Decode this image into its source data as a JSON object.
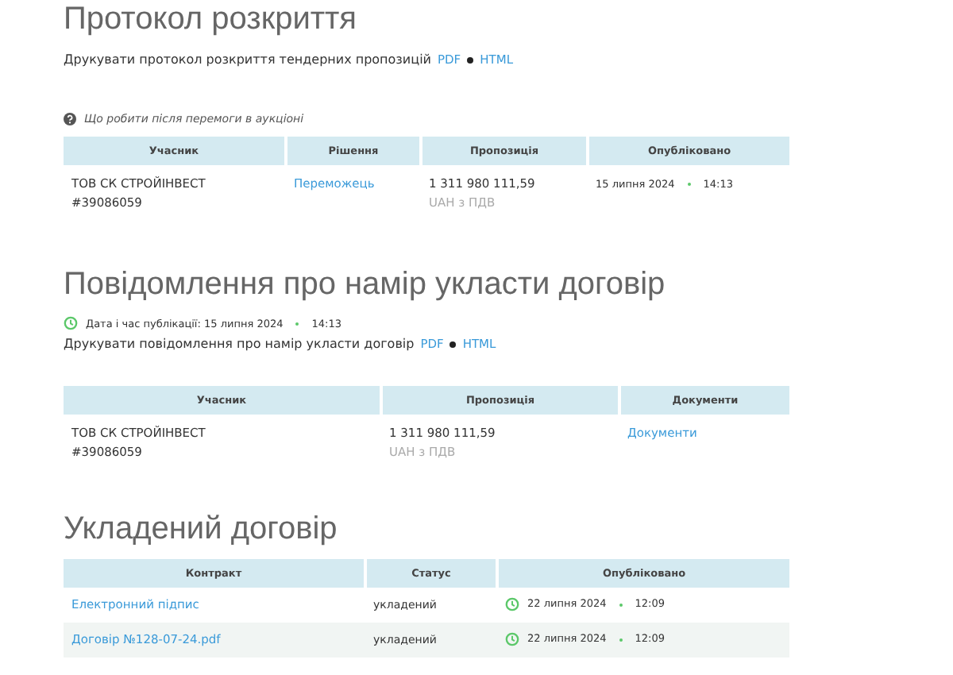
{
  "sections": [
    {
      "title": "Протокол розкриття",
      "print": {
        "text": "Друкувати протокол розкриття тендерних пропозицій",
        "links": [
          "PDF",
          "HTML"
        ]
      },
      "help": "Що робити після перемоги в аукціоні",
      "table": {
        "columns": [
          "Учасник",
          "Рішення",
          "Пропозиція",
          "Опубліковано"
        ],
        "rows": [
          [
            {
              "kind": "party",
              "name": "ТОВ СК СТРОЙІНВЕСТ",
              "code": "#39086059"
            },
            {
              "kind": "link",
              "text": "Переможець"
            },
            {
              "kind": "amount",
              "value": "1 311 980 111,59",
              "note": "UAH з ПДВ"
            },
            {
              "kind": "date",
              "date": "15 липня 2024",
              "time": "14:13"
            }
          ]
        ]
      }
    },
    {
      "title": "Повідомлення про намір укласти договір",
      "published": {
        "label": "Дата і час публікації: 15 липня 2024",
        "time": "14:13"
      },
      "print": {
        "text": "Друкувати повідомлення про намір укласти договір",
        "links": [
          "PDF",
          "HTML"
        ]
      },
      "table": {
        "columns": [
          "Учасник",
          "Пропозиція",
          "Документи"
        ],
        "rows": [
          [
            {
              "kind": "party",
              "name": "ТОВ СК СТРОЙІНВЕСТ",
              "code": "#39086059"
            },
            {
              "kind": "amount",
              "value": "1 311 980 111,59",
              "note": "UAH з ПДВ"
            },
            {
              "kind": "link",
              "text": "Документи"
            }
          ]
        ]
      }
    },
    {
      "title": "Укладений договір",
      "table": {
        "columns": [
          "Контракт",
          "Статус",
          "Опубліковано"
        ],
        "rows": [
          [
            {
              "kind": "link",
              "text": "Електронний підпис"
            },
            {
              "kind": "text",
              "text": "укладений"
            },
            {
              "kind": "clockdate",
              "date": "22 липня 2024",
              "time": "12:09"
            }
          ],
          [
            {
              "kind": "link",
              "text": "Договір №128-07-24.pdf"
            },
            {
              "kind": "text",
              "text": "укладений"
            },
            {
              "kind": "clockdate",
              "date": "22 липня 2024",
              "time": "12:09"
            }
          ]
        ]
      }
    }
  ]
}
